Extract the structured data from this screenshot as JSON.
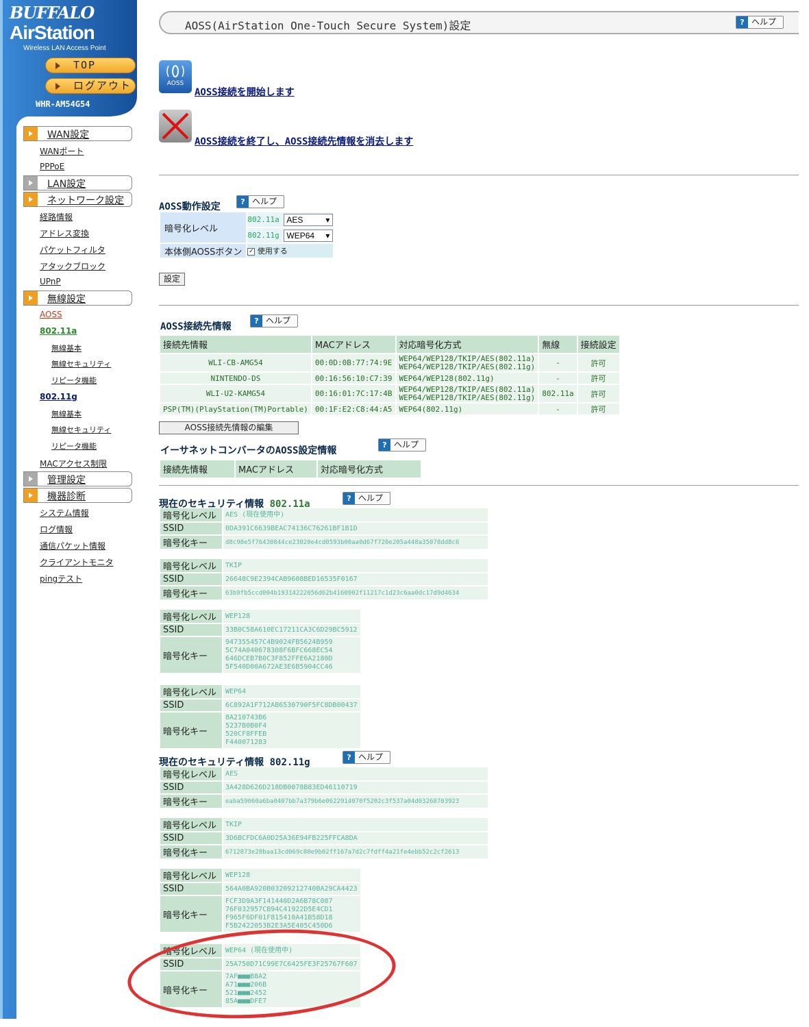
{
  "sidebar": {
    "brand": "BUFFALO",
    "product": "AirStation",
    "tagline": "Wireless LAN Access Point",
    "top_button": "TOP",
    "logout_button": "ログアウト",
    "model": "WHR-AM54G54",
    "sections": {
      "wan": "WAN設定",
      "lan": "LAN設定",
      "network": "ネットワーク設定",
      "wireless": "無線設定",
      "admin": "管理設定",
      "diag": "機器診断"
    },
    "items": {
      "wan_port": "WANポート",
      "pppoe": "PPPoE",
      "route": "経路情報",
      "nat": "アドレス変換",
      "packet_filter": "パケットフィルタ",
      "attack_block": "アタックブロック",
      "upnp": "UPnP",
      "aoss": "AOSS",
      "a11a": "802.11a",
      "a_basic": "無線基本",
      "a_security": "無線セキュリティ",
      "a_repeater": "リピータ機能",
      "g11g": "802.11g",
      "g_basic": "無線基本",
      "g_security": "無線セキュリティ",
      "g_repeater": "リピータ機能",
      "mac_access": "MACアクセス制限",
      "sysinfo": "システム情報",
      "log": "ログ情報",
      "packet_info": "通信パケット情報",
      "client_monitor": "クライアントモニタ",
      "ping": "pingテスト"
    }
  },
  "main": {
    "title": "AOSS(AirStation One-Touch Secure System)設定",
    "help_label": "ヘルプ",
    "help_q": "?",
    "icon_text": "AOSS",
    "start_link": "AOSS接続を開始します",
    "end_link": "AOSS接続を終了し、AOSS接続先情報を消去します",
    "op_heading": "AOSS動作設定",
    "op": {
      "enc_label": "暗号化レベル",
      "band_a": "802.11a",
      "band_a_value": "AES",
      "band_g": "802.11g",
      "band_g_value": "WEP64",
      "button_label": "本体側AOSSボタン",
      "button_value": "使用する"
    },
    "set_button": "設定",
    "conn_heading": "AOSS接続先情報",
    "conn_headers": [
      "接続先情報",
      "MACアドレス",
      "対応暗号化方式",
      "無線",
      "接続設定"
    ],
    "conn_rows": [
      {
        "name": "WLI-CB-AMG54",
        "mac": "00:0D:0B:77:74:9E",
        "enc1": "WEP64/WEP128/TKIP/AES(802.11a)",
        "enc2": "WEP64/WEP128/TKIP/AES(802.11g)",
        "radio": "-",
        "status": "許可"
      },
      {
        "name": "NINTENDO-DS",
        "mac": "00:16:56:10:C7:39",
        "enc1": "WEP64/WEP128(802.11g)",
        "enc2": "",
        "radio": "-",
        "status": "許可"
      },
      {
        "name": "WLI-U2-KAMG54",
        "mac": "00:16:01:7C:17:4B",
        "enc1": "WEP64/WEP128/TKIP/AES(802.11a)",
        "enc2": "WEP64/WEP128/TKIP/AES(802.11g)",
        "radio": "802.11a",
        "status": "許可"
      },
      {
        "name": "PSP(TM)(PlayStation(TM)Portable)",
        "mac": "00:1F:E2:C8:44:A5",
        "enc1": "WEP64(802.11g)",
        "enc2": "",
        "radio": "-",
        "status": "許可"
      }
    ],
    "edit_button": "AOSS接続先情報の編集",
    "ether_heading": "イーサネットコンバータのAOSS設定情報",
    "ether_headers": [
      "接続先情報",
      "MACアドレス",
      "対応暗号化方式"
    ],
    "sec_heading_prefix": "現在のセキュリティ情報",
    "band_a": "802.11a",
    "band_g": "802.11g",
    "label_level": "暗号化レベル",
    "label_ssid": "SSID",
    "label_key": "暗号化キー",
    "sec_a": [
      {
        "level": "AES (現在使用中)",
        "ssid": "0DA391C6639BEAC74136C76261BF1B1D",
        "key": "d8c98e5f76430844ce23020e4cd0593b00aa0d67f720e205a448a35078dd8c6"
      },
      {
        "level": "TKIP",
        "ssid": "26648C9E2394CAB9608BED16535F0167",
        "key": "63b9fb5ccd004b19314222056d62b4160902f11217c1d23c6aa0dc17d9d4634"
      },
      {
        "level": "WEP128",
        "ssid": "33B0C58A610EC17211CA3C6D29BC5912",
        "key": [
          "947355457C4B9024FB5624B959",
          "5C74A040678308F6BFC668EC54",
          "646DCEB7B0C3F852FFE6A2180D",
          "5F540D00A672AE3E6B5904CC46"
        ]
      },
      {
        "level": "WEP64",
        "ssid": "6C892A1F712AB6530790F5FC8DB00437",
        "key": [
          "8A210743B6",
          "5237B0B0F4",
          "520CF8FFEB",
          "F440071283"
        ]
      }
    ],
    "sec_g": [
      {
        "level": "AES",
        "ssid": "3A428D626D218DB0078B83ED46110719",
        "key": "eaba59060a6ba0407bb7a379b6e0622914070f5202c3f537a04d03268703923"
      },
      {
        "level": "TKIP",
        "ssid": "3D6BCFDC6A0D25A36E94FB225FFCA8DA",
        "key": "6712873e28baa13cd069c80e9b02ff167a7d2c7fdff4a21fe4ebb52c2cf2613"
      },
      {
        "level": "WEP128",
        "ssid": "564A0BA920B03209212740BA29CA4423",
        "key": [
          "FCF3D9A3F141440D2A6B78C087",
          "76F032957CB94C41922D5E4CD1",
          "F965F6DF01F815410A41B58D18",
          "F5B2422053B2E3A5E405C450D6"
        ]
      },
      {
        "level": "WEP64 (現在使用中)",
        "ssid": "25A750D71C99E7C6425FE3F25767F607",
        "key": [
          "7AF■■■B8A2",
          "A71■■■206B",
          "521■■■2452",
          "85A■■■DFE7"
        ]
      }
    ]
  },
  "colors": {
    "sidebar_blue": "#1b5fb0",
    "accent_orange": "#f0a020",
    "table_header_green": "#c7e3cf",
    "annotation_red": "#d33"
  }
}
